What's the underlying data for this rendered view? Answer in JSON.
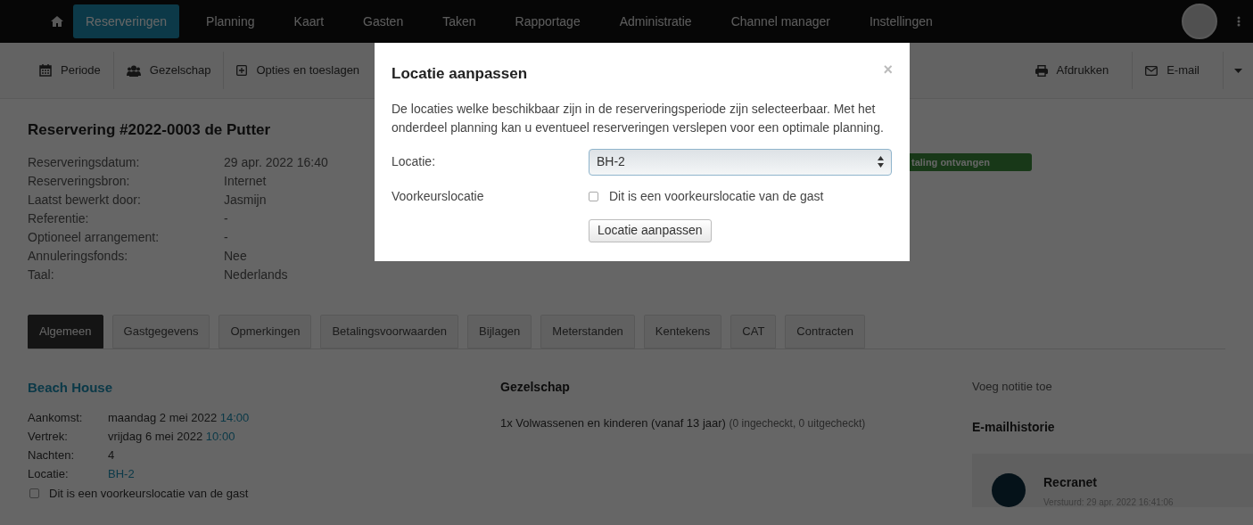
{
  "nav": {
    "items": [
      {
        "label": "Reserveringen",
        "selected": true
      },
      {
        "label": "Planning",
        "selected": false
      },
      {
        "label": "Kaart",
        "selected": false
      },
      {
        "label": "Gasten",
        "selected": false
      },
      {
        "label": "Taken",
        "selected": false
      },
      {
        "label": "Rapportage",
        "selected": false
      },
      {
        "label": "Administratie",
        "selected": false
      },
      {
        "label": "Channel manager",
        "selected": false
      },
      {
        "label": "Instellingen",
        "selected": false
      }
    ]
  },
  "toolbar": {
    "left": [
      {
        "label": "Periode"
      },
      {
        "label": "Gezelschap"
      },
      {
        "label": "Opties en toeslagen"
      }
    ],
    "right": [
      {
        "label": "Afdrukken"
      },
      {
        "label": "E-mail"
      }
    ]
  },
  "reservation": {
    "title": "Reservering #2022-0003 de Putter",
    "status_badge": "taling ontvangen",
    "details": [
      {
        "label": "Reserveringsdatum:",
        "value": "29 apr. 2022 16:40"
      },
      {
        "label": "Reserveringsbron:",
        "value": "Internet"
      },
      {
        "label": "Laatst bewerkt door:",
        "value": "Jasmijn"
      },
      {
        "label": "Referentie:",
        "value": "-"
      },
      {
        "label": "Optioneel arrangement:",
        "value": "-"
      },
      {
        "label": "Annuleringsfonds:",
        "value": "Nee"
      },
      {
        "label": "Taal:",
        "value": "Nederlands"
      }
    ]
  },
  "tabs": [
    {
      "label": "Algemeen",
      "selected": true
    },
    {
      "label": "Gastgegevens",
      "selected": false
    },
    {
      "label": "Opmerkingen",
      "selected": false
    },
    {
      "label": "Betalingsvoorwaarden",
      "selected": false
    },
    {
      "label": "Bijlagen",
      "selected": false
    },
    {
      "label": "Meterstanden",
      "selected": false
    },
    {
      "label": "Kentekens",
      "selected": false
    },
    {
      "label": "CAT",
      "selected": false
    },
    {
      "label": "Contracten",
      "selected": false
    }
  ],
  "accommodation": {
    "name": "Beach House",
    "rows": [
      {
        "label": "Aankomst:",
        "value": "maandag 2 mei 2022",
        "time": "14:00"
      },
      {
        "label": "Vertrek:",
        "value": "vrijdag 6 mei 2022",
        "time": "10:00"
      },
      {
        "label": "Nachten:",
        "value": "4"
      },
      {
        "label": "Locatie:",
        "link": "BH-2"
      }
    ],
    "preference": {
      "label": "Dit is een voorkeurslocatie van de gast",
      "checked": false
    }
  },
  "party": {
    "heading": "Gezelschap",
    "line": "1x Volwassenen en kinderen (vanaf 13 jaar)",
    "note": "(0 ingecheckt, 0 uitgecheckt)"
  },
  "side": {
    "add_note": "Voeg notitie toe",
    "email_heading": "E-mailhistorie",
    "email": {
      "sender": "Recranet",
      "sent": "Verstuurd: 29 apr. 2022 16:41:06"
    }
  },
  "modal": {
    "title": "Locatie aanpassen",
    "close": "×",
    "description": "De locaties welke beschikbaar zijn in de reserveringsperiode zijn selecteerbaar. Met het onderdeel planning kan u eventueel reserveringen verslepen voor een optimale planning.",
    "location_label": "Locatie:",
    "location_value": "BH-2",
    "preference_label": "Voorkeurslocatie",
    "preference": {
      "label": "Dit is een voorkeurslocatie van de gast",
      "checked": false
    },
    "button": "Locatie aanpassen"
  }
}
